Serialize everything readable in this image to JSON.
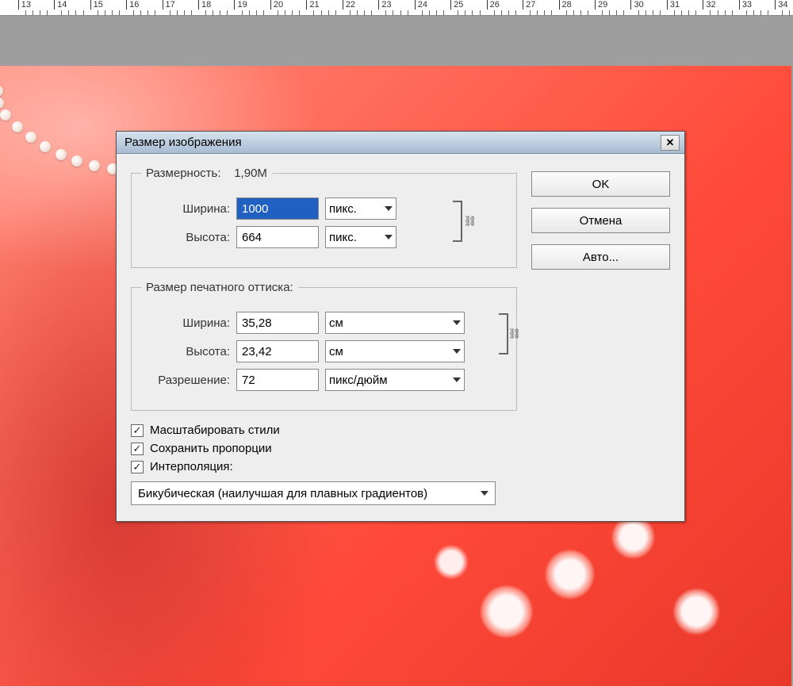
{
  "ruler": {
    "start": 13,
    "end": 34
  },
  "dialog": {
    "title": "Размер изображения",
    "pixel_dim": {
      "legend": "Размерность:",
      "size_label": "1,90M",
      "width_label": "Ширина:",
      "width_value": "1000",
      "height_label": "Высота:",
      "height_value": "664",
      "unit": "пикс."
    },
    "doc_size": {
      "legend": "Размер печатного оттиска:",
      "width_label": "Ширина:",
      "width_value": "35,28",
      "height_label": "Высота:",
      "height_value": "23,42",
      "unit": "см",
      "res_label": "Разрешение:",
      "res_value": "72",
      "res_unit": "пикс/дюйм"
    },
    "checkboxes": {
      "scale_styles": "Масштабировать стили",
      "constrain": "Сохранить пропорции",
      "resample": "Интерполяция:"
    },
    "interp": "Бикубическая (наилучшая для плавных градиентов)",
    "buttons": {
      "ok": "OK",
      "cancel": "Отмена",
      "auto": "Авто..."
    }
  }
}
